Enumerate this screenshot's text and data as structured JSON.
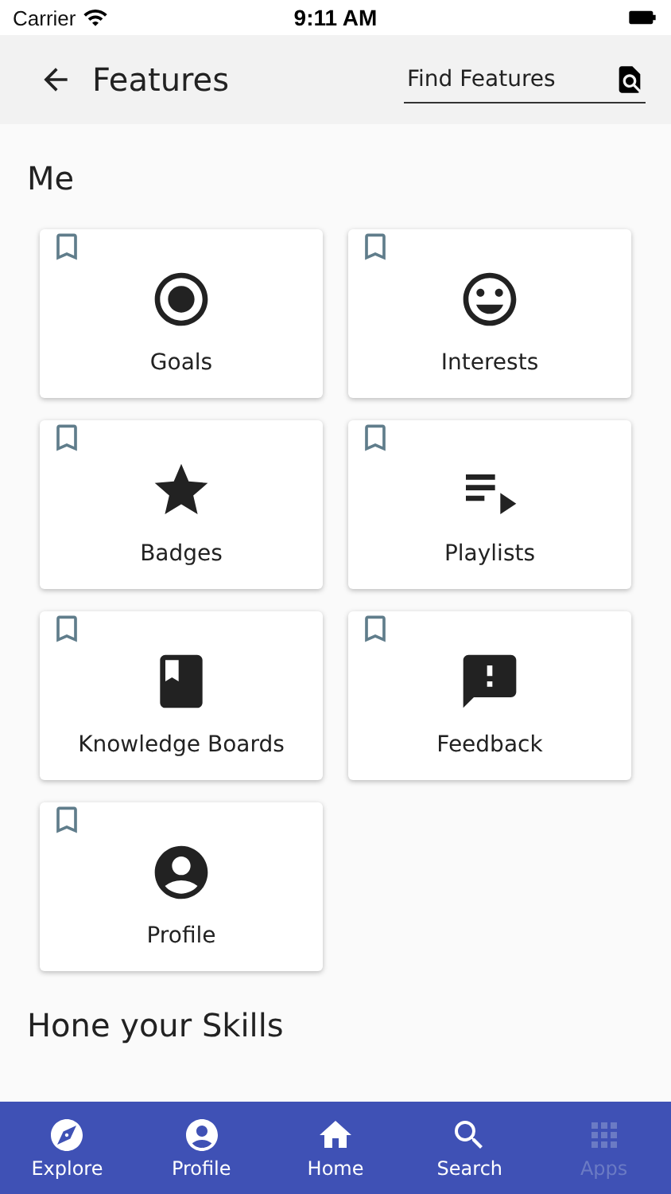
{
  "status_bar": {
    "carrier": "Carrier",
    "time": "9:11 AM"
  },
  "header": {
    "title": "Features",
    "search": {
      "placeholder": "Find Features"
    }
  },
  "sections": [
    {
      "title": "Me",
      "cards": [
        {
          "label": "Goals",
          "kind": "target",
          "bookmarked": false
        },
        {
          "label": "Interests",
          "kind": "smile",
          "bookmarked": false
        },
        {
          "label": "Badges",
          "kind": "star",
          "bookmarked": false
        },
        {
          "label": "Playlists",
          "kind": "playlist",
          "bookmarked": false
        },
        {
          "label": "Knowledge Boards",
          "kind": "book",
          "bookmarked": false
        },
        {
          "label": "Feedback",
          "kind": "feedback",
          "bookmarked": false
        },
        {
          "label": "Profile",
          "kind": "person",
          "bookmarked": false
        }
      ]
    },
    {
      "title": "Hone your Skills"
    }
  ],
  "bottom_nav": [
    {
      "label": "Explore",
      "kind": "compass",
      "disabled": false
    },
    {
      "label": "Profile",
      "kind": "person",
      "disabled": false
    },
    {
      "label": "Home",
      "kind": "home",
      "disabled": false
    },
    {
      "label": "Search",
      "kind": "search",
      "disabled": false
    },
    {
      "label": "Apps",
      "kind": "grid",
      "disabled": true
    }
  ]
}
